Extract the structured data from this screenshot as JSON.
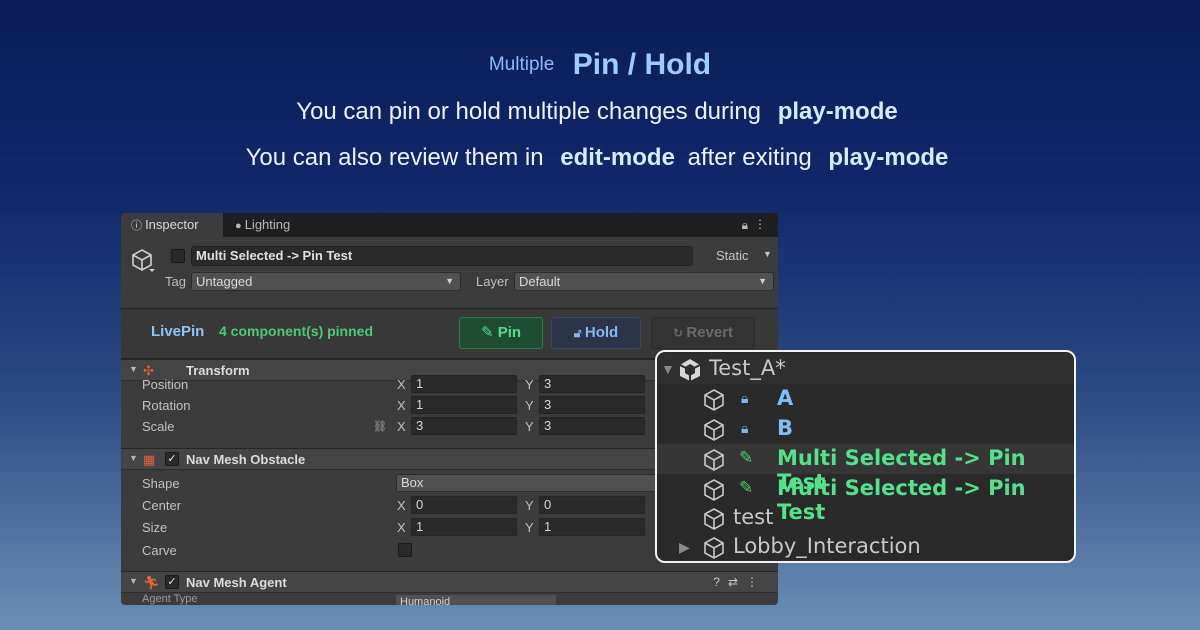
{
  "headline": {
    "prefix": "Multiple",
    "title": "Pin / Hold",
    "line2_text": "You can pin or hold multiple changes during",
    "line2_highlight": "play-mode",
    "line3_text_a": "You can also review them in",
    "line3_highlight_a": "edit-mode",
    "line3_text_b": "after exiting",
    "line3_highlight_b": "play-mode"
  },
  "inspector": {
    "tabs": {
      "inspector_label": "Inspector",
      "lighting_label": "Lighting"
    },
    "object": {
      "enabled_mark": "✓",
      "name": "Multi Selected -> Pin Test",
      "static_label": "Static",
      "tag_label": "Tag",
      "tag_value": "Untagged",
      "layer_label": "Layer",
      "layer_value": "Default"
    },
    "livepin": {
      "title": "LivePin",
      "count": "4 component(s) pinned",
      "pin_label": "Pin",
      "hold_label": "Hold",
      "revert_label": "Revert"
    },
    "transform": {
      "title": "Transform",
      "position_label": "Position",
      "rotation_label": "Rotation",
      "scale_label": "Scale",
      "x_axis": "X",
      "y_axis": "Y",
      "position": {
        "x": "1",
        "y": "3"
      },
      "rotation": {
        "x": "1",
        "y": "3"
      },
      "scale": {
        "x": "3",
        "y": "3"
      }
    },
    "nav_mesh_obstacle": {
      "title": "Nav Mesh Obstacle",
      "shape_label": "Shape",
      "shape_value": "Box",
      "center_label": "Center",
      "size_label": "Size",
      "carve_label": "Carve",
      "center": {
        "x": "0",
        "y": "0"
      },
      "size": {
        "x": "1",
        "y": "1"
      }
    },
    "nav_mesh_agent": {
      "title": "Nav Mesh Agent",
      "agent_type_label": "Agent Type",
      "agent_type_value": "Humanoid"
    }
  },
  "hierarchy": {
    "root": "Test_A*",
    "items": [
      {
        "label": "A",
        "state": "hold"
      },
      {
        "label": "B",
        "state": "hold"
      },
      {
        "label": "Multi Selected -> Pin Test",
        "state": "pin"
      },
      {
        "label": "Multi Selected -> Pin Test",
        "state": "pin"
      },
      {
        "label": "test",
        "state": "none"
      },
      {
        "label": "Lobby_Interaction",
        "state": "none"
      }
    ]
  },
  "colors": {
    "pin_green": "#4ec97a",
    "hold_blue": "#82bdf5",
    "background_top": "#0a1d57",
    "background_bottom": "#6b8fb7"
  }
}
